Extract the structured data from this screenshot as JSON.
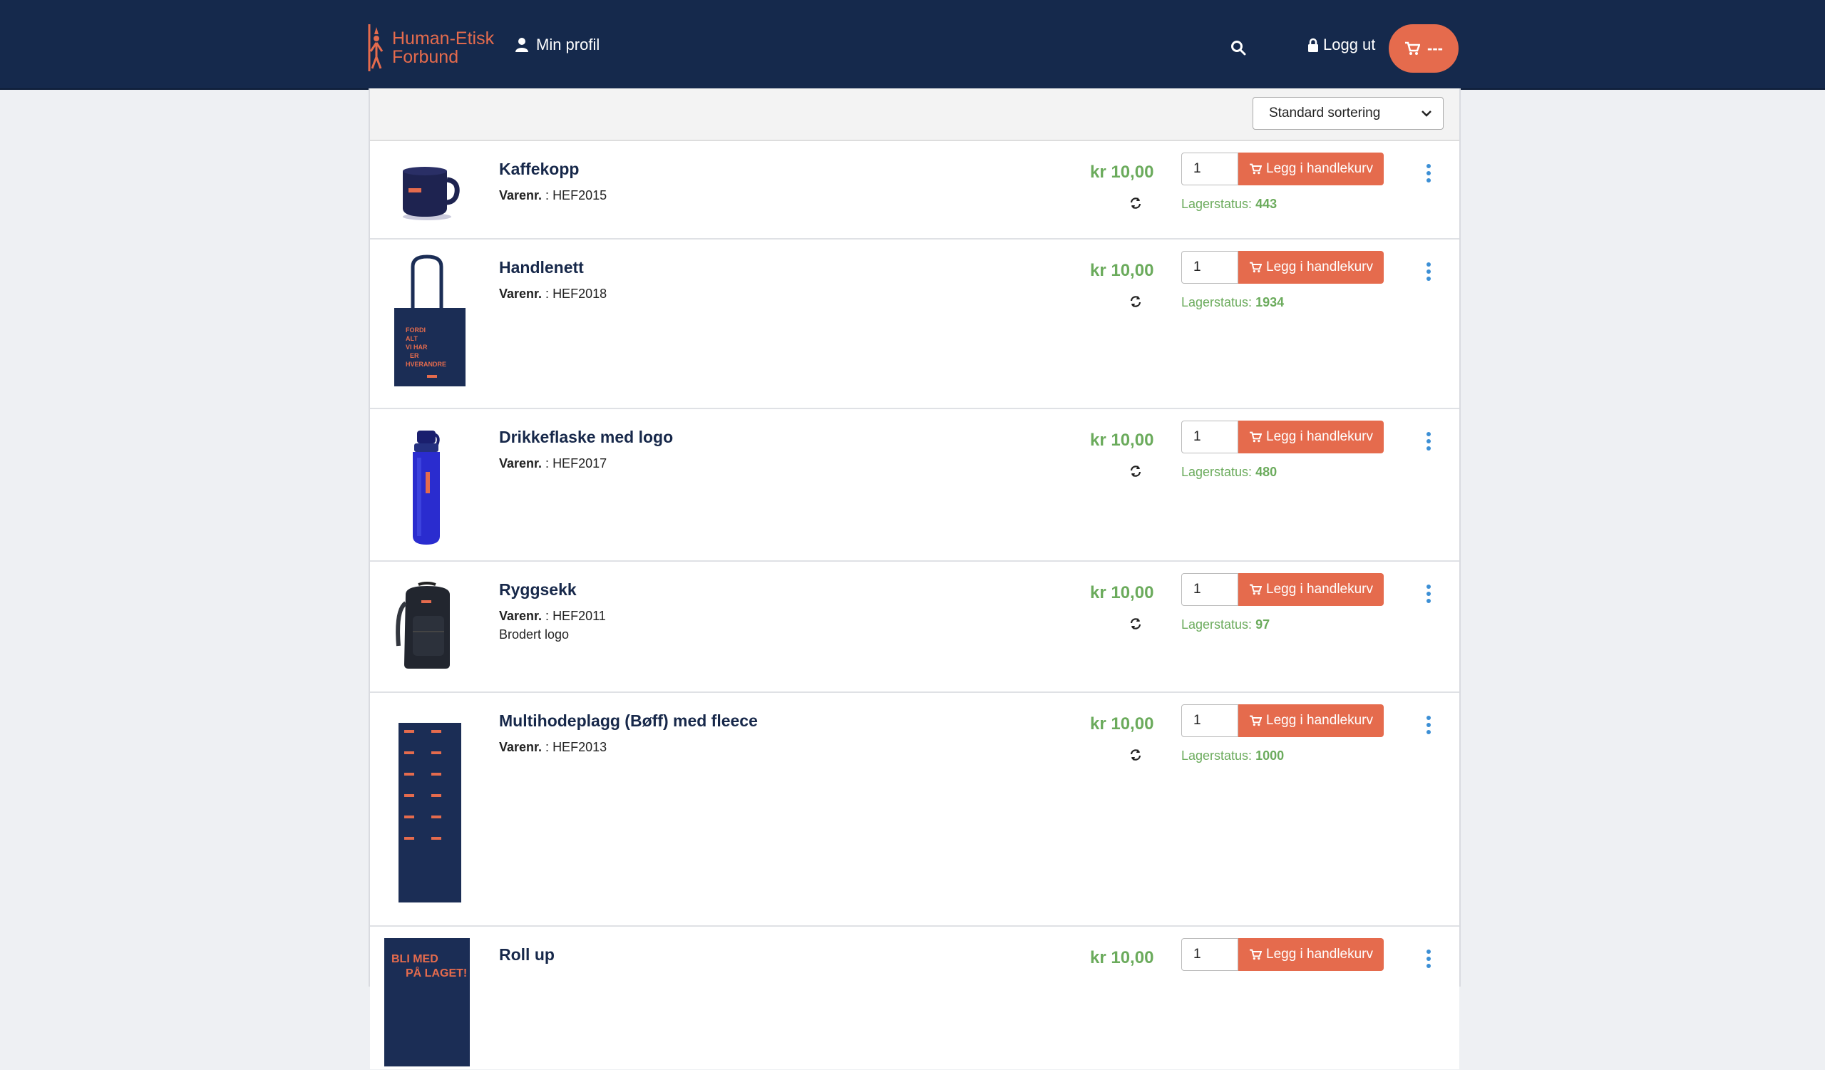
{
  "header": {
    "logo_line1": "Human-Etisk",
    "logo_line2": "Forbund",
    "profile_label": "Min profil",
    "logout_label": "Logg ut",
    "cart_label": "---",
    "colors": {
      "navy": "#15294c",
      "accent": "#e56b4d"
    }
  },
  "toolbar": {
    "sort_selected": "Standard sortering"
  },
  "labels": {
    "sku_label": "Varenr.",
    "sku_sep": " : ",
    "add_to_cart": "Legg i handlekurv",
    "stock_label": "Lagerstatus: "
  },
  "products": [
    {
      "name": "Kaffekopp",
      "sku": "HEF2015",
      "price": "kr 10,00",
      "qty": "1",
      "stock": "443",
      "icon": "mug-icon"
    },
    {
      "name": "Handlenett",
      "sku": "HEF2018",
      "price": "kr 10,00",
      "qty": "1",
      "stock": "1934",
      "icon": "tote-bag-icon",
      "image_text": [
        "FORDI",
        "ALT",
        "VI HAR",
        "ER",
        "HVERANDRE"
      ]
    },
    {
      "name": "Drikkeflaske med logo",
      "sku": "HEF2017",
      "price": "kr 10,00",
      "qty": "1",
      "stock": "480",
      "icon": "bottle-icon"
    },
    {
      "name": "Ryggsekk",
      "sku": "HEF2011",
      "note": "Brodert logo",
      "price": "kr 10,00",
      "qty": "1",
      "stock": "97",
      "icon": "backpack-icon"
    },
    {
      "name": "Multihodeplagg (Bøff) med fleece",
      "sku": "HEF2013",
      "price": "kr 10,00",
      "qty": "1",
      "stock": "1000",
      "icon": "neck-gaiter-icon"
    },
    {
      "name": "Roll up",
      "price": "kr 10,00",
      "qty": "1",
      "icon": "rollup-banner-icon",
      "image_text": [
        "BLI MED",
        "PÅ LAGET!"
      ]
    }
  ]
}
